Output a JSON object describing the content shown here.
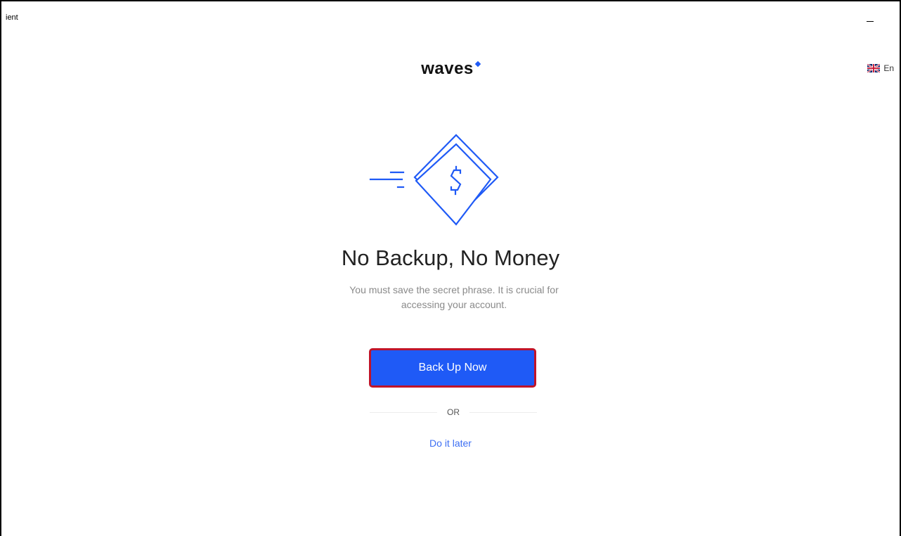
{
  "window": {
    "title": "ient"
  },
  "header": {
    "logo_text": "waves",
    "language_label": "En",
    "language_flag_icon": "uk-flag-icon"
  },
  "colors": {
    "brand_blue": "#1f5af6",
    "highlight_border": "#c01429",
    "link_blue": "#3d6ff3",
    "muted_text": "#8a8a8a"
  },
  "main": {
    "illustration_icon": "dollar-diamond-speed-icon",
    "title": "No Backup, No Money",
    "description": "You must save the secret phrase. It is crucial for accessing your account.",
    "primary_button_label": "Back Up Now",
    "divider_label": "OR",
    "secondary_link_label": "Do it later"
  }
}
